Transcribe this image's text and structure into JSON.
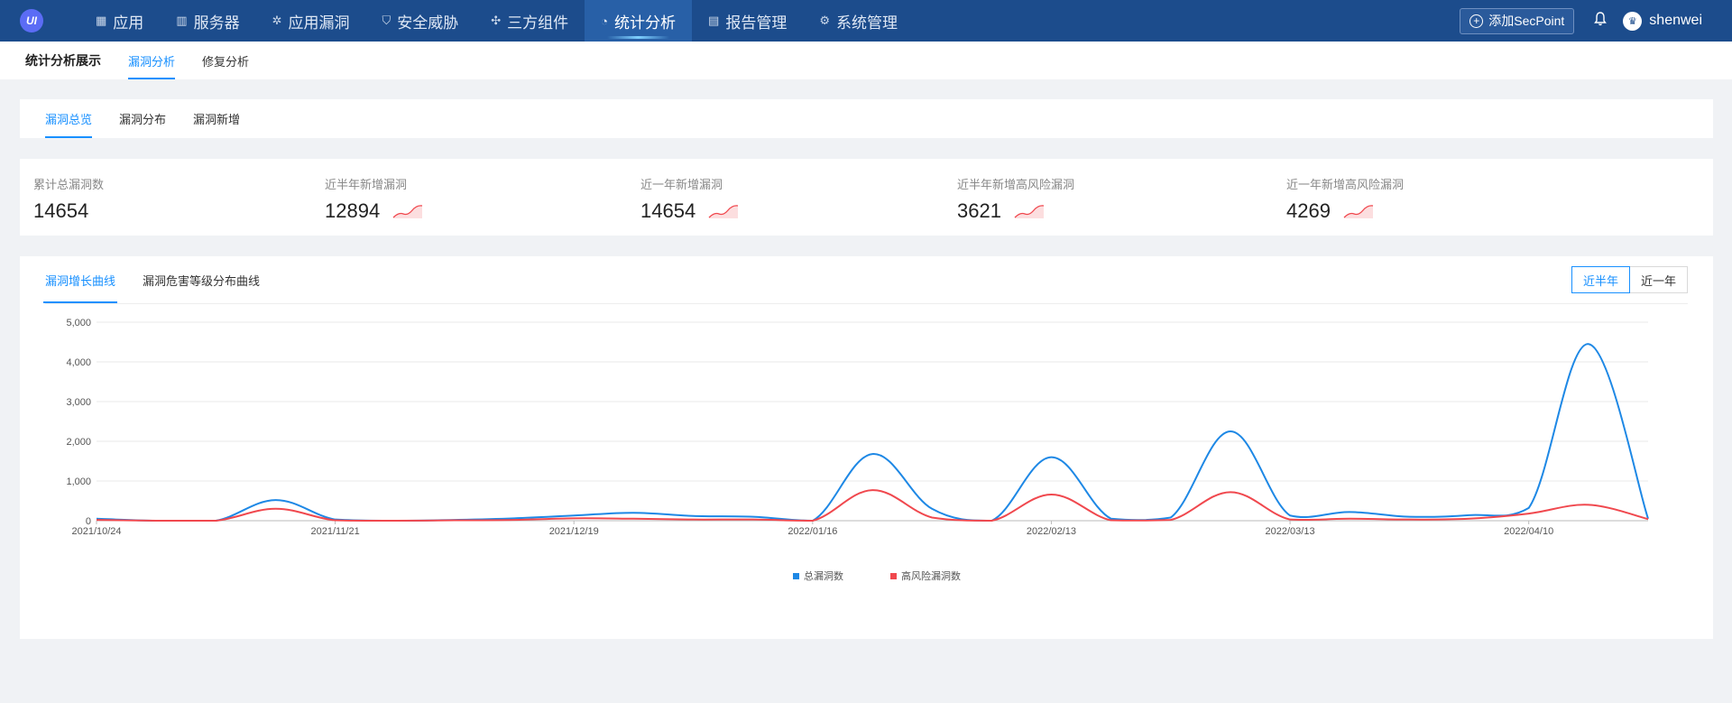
{
  "app": {
    "logo_text": "UI"
  },
  "nav": {
    "items": [
      {
        "icon": "grid-icon",
        "glyph": "▦",
        "label": "应用"
      },
      {
        "icon": "server-icon",
        "glyph": "▥",
        "label": "服务器"
      },
      {
        "icon": "bug-icon",
        "glyph": "✲",
        "label": "应用漏洞"
      },
      {
        "icon": "shield-icon",
        "glyph": "⛉",
        "label": "安全威胁"
      },
      {
        "icon": "component-icon",
        "glyph": "✣",
        "label": "三方组件"
      },
      {
        "icon": "pie-chart-icon",
        "glyph": "◔",
        "label": "统计分析",
        "active": true
      },
      {
        "icon": "report-icon",
        "glyph": "▤",
        "label": "报告管理"
      },
      {
        "icon": "gear-icon",
        "glyph": "⚙",
        "label": "系统管理"
      }
    ],
    "add_button": "添加SecPoint",
    "user": "shenwei"
  },
  "subnav": {
    "title": "统计分析展示",
    "tabs": [
      {
        "label": "漏洞分析",
        "active": true
      },
      {
        "label": "修复分析"
      }
    ]
  },
  "vuln_tabs": [
    {
      "label": "漏洞总览",
      "active": true
    },
    {
      "label": "漏洞分布"
    },
    {
      "label": "漏洞新增"
    }
  ],
  "stats": [
    {
      "label": "累计总漏洞数",
      "value": "14654",
      "spark": false
    },
    {
      "label": "近半年新增漏洞",
      "value": "12894",
      "spark": true
    },
    {
      "label": "近一年新增漏洞",
      "value": "14654",
      "spark": true
    },
    {
      "label": "近半年新增高风险漏洞",
      "value": "3621",
      "spark": true
    },
    {
      "label": "近一年新增高风险漏洞",
      "value": "4269",
      "spark": true
    }
  ],
  "chart_tabs": [
    {
      "label": "漏洞增长曲线",
      "active": true
    },
    {
      "label": "漏洞危害等级分布曲线"
    }
  ],
  "range_buttons": [
    {
      "label": "近半年",
      "active": true
    },
    {
      "label": "近一年"
    }
  ],
  "colors": {
    "total": "#1e88e5",
    "high": "#f0484e",
    "accent": "#1890ff",
    "topbar": "#1c4c8c"
  },
  "chart_data": {
    "type": "line",
    "title": "",
    "xlabel": "",
    "ylabel": "",
    "x_tick_labels": [
      "2021/10/24",
      "2021/11/21",
      "2021/12/19",
      "2022/01/16",
      "2022/02/13",
      "2022/03/13",
      "2022/04/10"
    ],
    "ylim": [
      0,
      5000
    ],
    "y_ticks": [
      0,
      1000,
      2000,
      3000,
      4000,
      5000
    ],
    "y_tick_labels": [
      "0",
      "1,000",
      "2,000",
      "3,000",
      "4,000",
      "5,000"
    ],
    "x": [
      "2021/10/24",
      "2021/10/31",
      "2021/11/07",
      "2021/11/14",
      "2021/11/21",
      "2021/11/28",
      "2021/12/05",
      "2021/12/12",
      "2021/12/19",
      "2021/12/26",
      "2022/01/02",
      "2022/01/09",
      "2022/01/16",
      "2022/01/23",
      "2022/01/30",
      "2022/02/06",
      "2022/02/13",
      "2022/02/20",
      "2022/02/27",
      "2022/03/06",
      "2022/03/13",
      "2022/03/20",
      "2022/03/27",
      "2022/04/03",
      "2022/04/10",
      "2022/04/17",
      "2022/04/24"
    ],
    "series": [
      {
        "name": "总漏洞数",
        "color": "#1e88e5",
        "values": [
          50,
          0,
          0,
          520,
          30,
          0,
          20,
          60,
          130,
          200,
          120,
          100,
          0,
          1680,
          300,
          0,
          1600,
          50,
          80,
          2250,
          130,
          220,
          100,
          140,
          320,
          4450,
          50
        ]
      },
      {
        "name": "高风险漏洞数",
        "color": "#f0484e",
        "values": [
          20,
          0,
          0,
          300,
          10,
          0,
          10,
          20,
          60,
          50,
          30,
          30,
          0,
          770,
          80,
          0,
          660,
          10,
          20,
          720,
          30,
          50,
          30,
          50,
          180,
          400,
          40
        ]
      }
    ],
    "legend_position": "bottom-center",
    "grid": true
  }
}
